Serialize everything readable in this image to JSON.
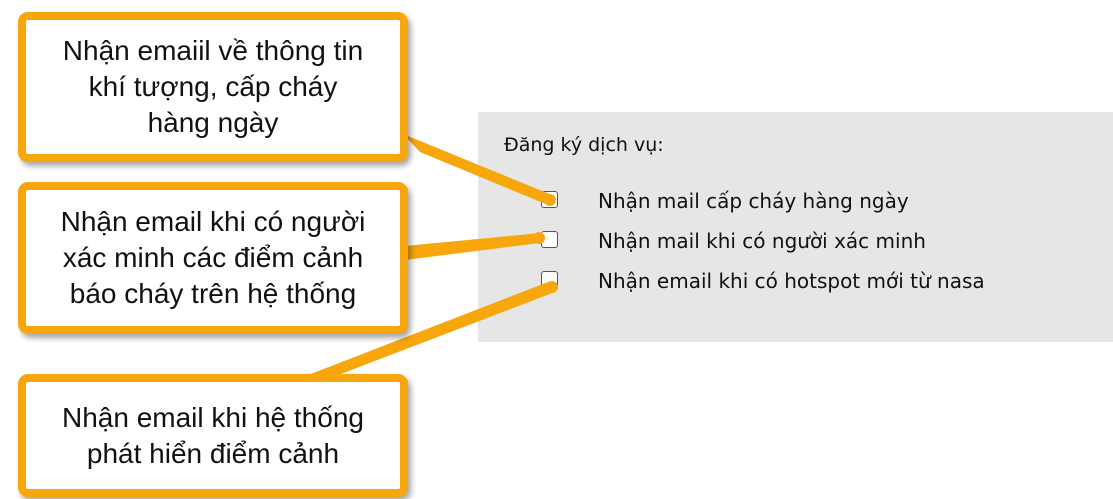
{
  "panel": {
    "title": "Đăng ký dịch vụ:",
    "options": [
      {
        "label": "Nhận mail cấp cháy hàng ngày",
        "checked": false
      },
      {
        "label": "Nhận mail khi có người xác minh",
        "checked": false
      },
      {
        "label": "Nhận email khi có hotspot mới từ nasa",
        "checked": false
      }
    ]
  },
  "callouts": [
    {
      "lines": [
        "Nhận emaiil về thông tin",
        "khí tượng, cấp cháy",
        "hàng ngày"
      ]
    },
    {
      "lines": [
        "Nhận email khi có người",
        "xác minh các điểm cảnh",
        "báo cháy trên hệ thống"
      ]
    },
    {
      "lines": [
        "Nhận email khi hệ thống",
        "phát hiển điểm cảnh"
      ]
    }
  ],
  "colors": {
    "callout_border": "#f7a70b",
    "panel_bg": "#e6e6e6"
  }
}
